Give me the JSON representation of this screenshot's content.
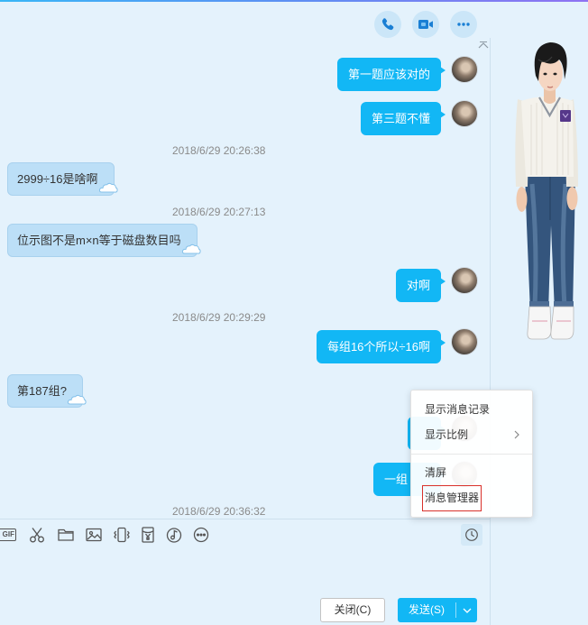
{
  "theme": {
    "background": "#e4f2fc",
    "accent": "#12b7f5",
    "incoming_bubble": "#bcdff7",
    "menu_highlight_border": "#d9312b"
  },
  "header": {
    "actions": [
      {
        "icon": "phone-icon"
      },
      {
        "icon": "video-icon"
      },
      {
        "icon": "more-icon"
      }
    ],
    "collapse_icon": "chevron-up-icon"
  },
  "chat": [
    {
      "text": "第一题应该对的",
      "outgoing": true
    },
    {
      "text": "第三题不懂",
      "outgoing": true
    },
    {
      "time": "2018/6/29 20:26:38"
    },
    {
      "text": "2999÷16是啥啊",
      "outgoing": false
    },
    {
      "time": "2018/6/29 20:27:13"
    },
    {
      "text": "位示图不是m×n等于磁盘数目吗",
      "outgoing": false
    },
    {
      "text": "对啊",
      "outgoing": true
    },
    {
      "time": "2018/6/29 20:29:29"
    },
    {
      "text": "每组16个所以÷16啊",
      "outgoing": true
    },
    {
      "text": "第187组?",
      "outgoing": false
    },
    {
      "text": "",
      "outgoing": true
    },
    {
      "text": "一组",
      "outgoing": true
    },
    {
      "time": "2018/6/29 20:36:32"
    }
  ],
  "toolbar": {
    "gif_label": "GIF",
    "items": [
      "gif-icon",
      "scissors-icon",
      "folder-icon",
      "image-icon",
      "vibrate-icon",
      "red-envelope-icon",
      "music-icon",
      "more-icon"
    ],
    "history_icon": "clock-icon"
  },
  "buttons": {
    "close_label": "关闭(C)",
    "send_label": "发送(S)",
    "send_menu_icon": "chevron-down-icon"
  },
  "context_menu": {
    "items": [
      {
        "label": "显示消息记录"
      },
      {
        "label": "显示比例",
        "submenu_icon": "chevron-right-icon"
      },
      {
        "label": "清屏"
      },
      {
        "label": "消息管理器",
        "highlighted": true
      }
    ]
  }
}
